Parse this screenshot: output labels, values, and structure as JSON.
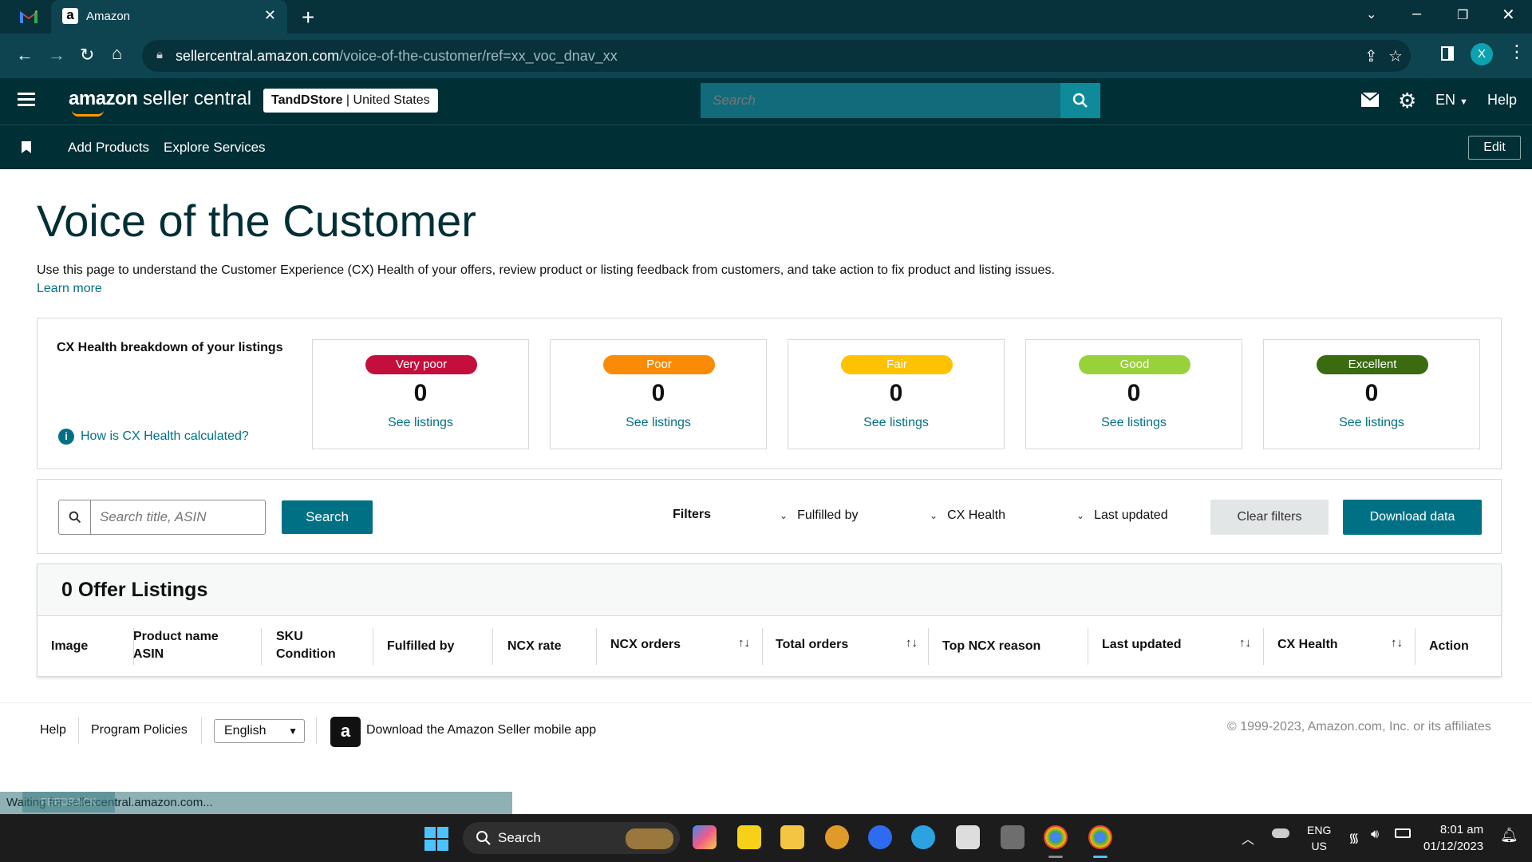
{
  "browser": {
    "tab_title": "Amazon",
    "tab_favicon": "a",
    "url_host": "sellercentral.amazon.com",
    "url_path": "/voice-of-the-customer/ref=xx_voc_dnav_xx",
    "profile_initial": "X",
    "status_text": "Waiting for sellercentral.amazon.com...",
    "status_overlay": "FEEDBACK"
  },
  "header": {
    "brand_bold": "amazon",
    "brand_rest": " seller central",
    "store_name": "TandDStore",
    "store_sep": " | ",
    "store_region": "United States",
    "search_placeholder": "Search",
    "language": "EN",
    "help": "Help"
  },
  "subnav": {
    "items": [
      "Add Products",
      "Explore Services"
    ],
    "edit": "Edit"
  },
  "page": {
    "title": "Voice of the Customer",
    "description": "Use this page to understand the Customer Experience (CX) Health of your offers, review product or listing feedback from customers, and take action to fix product and listing issues.",
    "learn_more": "Learn more"
  },
  "cx_health": {
    "heading": "CX Health breakdown of your listings",
    "how_link": "How is CX Health calculated?",
    "cards": [
      {
        "label": "Very poor",
        "count": "0",
        "link": "See listings",
        "color": "#c40f3c"
      },
      {
        "label": "Poor",
        "count": "0",
        "link": "See listings",
        "color": "#fa8b07"
      },
      {
        "label": "Fair",
        "count": "0",
        "link": "See listings",
        "color": "#ffc200"
      },
      {
        "label": "Good",
        "count": "0",
        "link": "See listings",
        "color": "#98d13a"
      },
      {
        "label": "Excellent",
        "count": "0",
        "link": "See listings",
        "color": "#3a6b10"
      }
    ]
  },
  "filters": {
    "search_placeholder": "Search title, ASIN",
    "search_button": "Search",
    "label": "Filters",
    "dropdowns": [
      "Fulfilled by",
      "CX Health",
      "Last updated"
    ],
    "clear": "Clear filters",
    "download": "Download data"
  },
  "listings": {
    "title": "0 Offer Listings",
    "columns": {
      "image": "Image",
      "product_name": "Product name",
      "asin": "ASIN",
      "sku": "SKU",
      "condition": "Condition",
      "fulfilled_by": "Fulfilled by",
      "ncx_rate": "NCX rate",
      "ncx_orders": "NCX orders",
      "total_orders": "Total orders",
      "top_ncx_reason": "Top NCX reason",
      "last_updated": "Last updated",
      "cx_health": "CX Health",
      "action": "Action"
    }
  },
  "footer": {
    "help": "Help",
    "program_policies": "Program Policies",
    "language_selected": "English",
    "app_text": "Download the Amazon Seller mobile app",
    "copyright": "© 1999-2023, Amazon.com, Inc. or its affiliates"
  },
  "taskbar": {
    "search": "Search",
    "lang_line1": "ENG",
    "lang_line2": "US",
    "time": "8:01 am",
    "date": "01/12/2023"
  }
}
